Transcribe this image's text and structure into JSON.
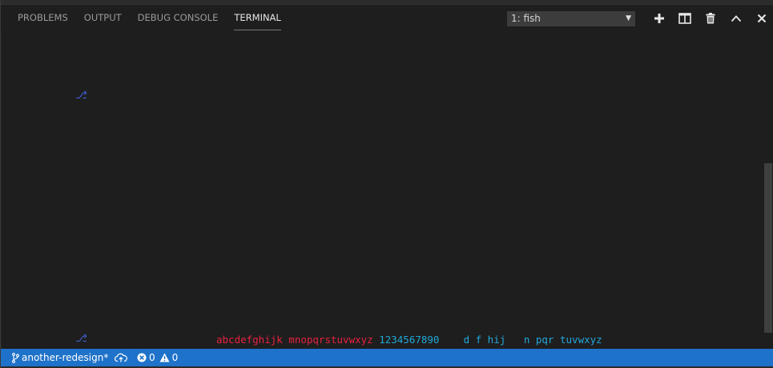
{
  "panel": {
    "tabs": [
      {
        "label": "PROBLEMS"
      },
      {
        "label": "OUTPUT"
      },
      {
        "label": "DEBUG CONSOLE"
      },
      {
        "label": "TERMINAL"
      }
    ],
    "active_tab": "TERMINAL",
    "terminal_select": {
      "value": "1: fish"
    },
    "actions": [
      "plus-icon",
      "split-icon",
      "trash-icon",
      "chevron-up-icon",
      "close-icon"
    ]
  },
  "terminal": {
    "prompt_glyph": "⎇",
    "output": {
      "red": "abcdefghijk mnopqrstuvwxyz",
      "numbers": "1234567890",
      "tail": "d f hij   n pqr tuvwxyz"
    }
  },
  "statusbar": {
    "branch": "another-redesign*",
    "errors": "0",
    "warnings": "0"
  },
  "colors": {
    "background": "#1e1e1e",
    "statusbar": "#1f72c9",
    "prompt": "#3d5ccc",
    "red_text": "#e8213f",
    "cyan_text": "#1fa8d8"
  }
}
